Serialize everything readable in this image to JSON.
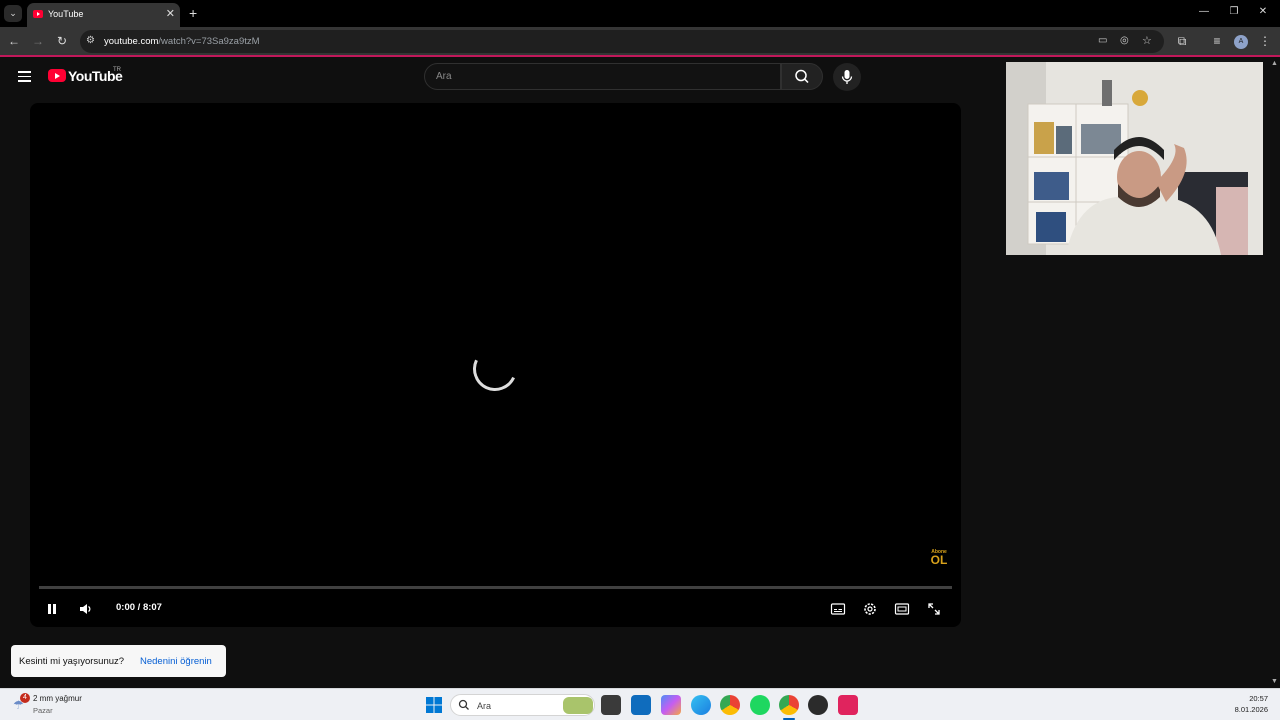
{
  "browser": {
    "tab_title": "YouTube",
    "url_host": "youtube.com",
    "url_path": "/watch?v=73Sa9za9tzM"
  },
  "youtube": {
    "logo_text": "YouTube",
    "region": "TR",
    "search_placeholder": "Ara"
  },
  "player": {
    "time_current": "0:00",
    "time_separator": " / ",
    "time_total": "8:07",
    "progress": 0,
    "watermark_line1": "Abone",
    "watermark_line2": "OL"
  },
  "toast": {
    "message": "Kesinti mi yaşıyorsunuz?",
    "link": "Nedenini öğrenin"
  },
  "taskbar": {
    "weather_badge": "4",
    "weather_text": "2 mm yağmur",
    "weather_day": "Pazar",
    "search_label": "Ara",
    "time": "20:57",
    "date": "8.01.2026"
  },
  "colors": {
    "youtube_red": "#ff0033",
    "toolbar_accent": "#c2185b",
    "link_blue": "#065fd4"
  }
}
